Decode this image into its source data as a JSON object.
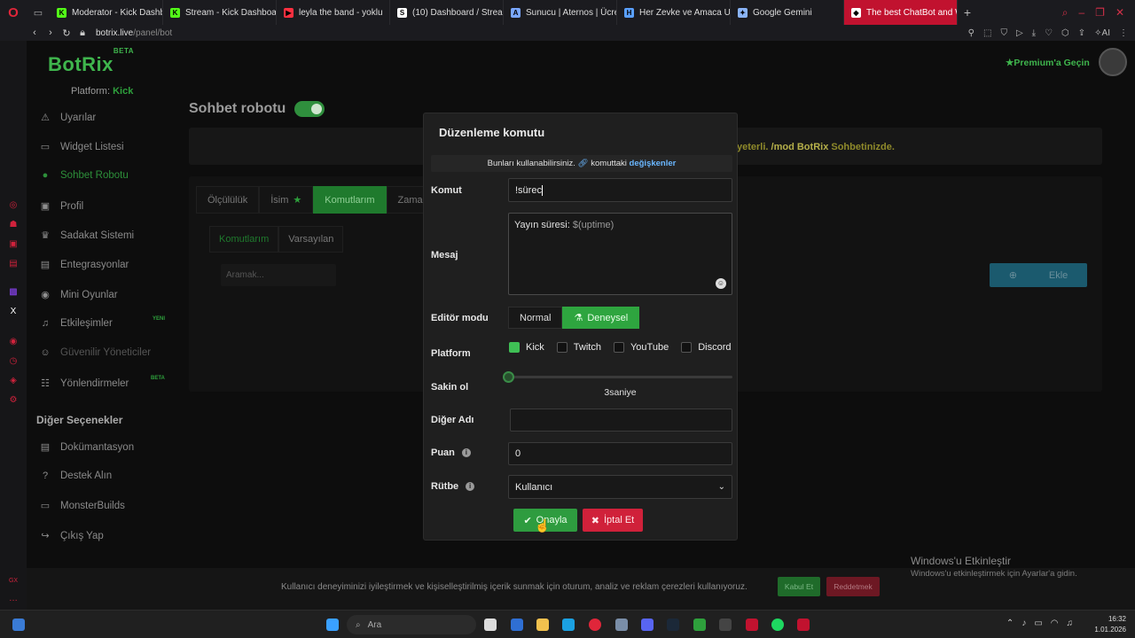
{
  "browser": {
    "tabs": [
      {
        "title": "Moderator - Kick Dashboa",
        "fav_color": "#53fc18",
        "fav": "K"
      },
      {
        "title": "Stream - Kick Dashboard",
        "fav_color": "#53fc18",
        "fav": "K"
      },
      {
        "title": "leyla the band - yoklu",
        "fav_color": "#ff3040",
        "fav": "▶"
      },
      {
        "title": "(10) Dashboard / Streamla",
        "fav_color": "#ffffff",
        "fav": "S"
      },
      {
        "title": "Sunucu | Aternos | Ücretsi",
        "fav_color": "#7aa7ff",
        "fav": "A"
      },
      {
        "title": "Her Zevke ve Amaca Uygu",
        "fav_color": "#5aa0ff",
        "fav": "H"
      },
      {
        "title": "Google Gemini",
        "fav_color": "#8ab4f8",
        "fav": "✦"
      },
      {
        "title": "The best ChatBot and Wid",
        "fav_color": "#ffffff",
        "fav": "◆"
      }
    ],
    "url_host": "botrix.live",
    "url_path": "/panel/bot"
  },
  "site": {
    "logo": "BotRix",
    "logo_badge": "BETA",
    "platform_label": "Platform:",
    "platform_value": "Kick",
    "premium": "Premium'a Geçin",
    "accent": "#3fb54d"
  },
  "sidebar": {
    "items": [
      {
        "label": "Uyarılar",
        "icon": "⚠"
      },
      {
        "label": "Widget Listesi",
        "icon": "▭"
      },
      {
        "label": "Sohbet Robotu",
        "icon": "●"
      },
      {
        "label": "Profil",
        "icon": "▣"
      },
      {
        "label": "Sadakat Sistemi",
        "icon": "♛"
      },
      {
        "label": "Entegrasyonlar",
        "icon": "▤"
      },
      {
        "label": "Mini Oyunlar",
        "icon": "◉"
      },
      {
        "label": "Etkileşimler",
        "icon": "♫"
      },
      {
        "label": "Güvenilir Yöneticiler",
        "icon": "☺"
      },
      {
        "label": "Yönlendirmeler",
        "icon": "☷"
      }
    ],
    "badges": {
      "yeni": "YENI",
      "beta": "BETA"
    },
    "section": "Diğer Seçenekler",
    "others": [
      {
        "label": "Dokümantasyon",
        "icon": "▤"
      },
      {
        "label": "Destek Alın",
        "icon": "?"
      },
      {
        "label": "MonsterBuilds",
        "icon": "▭"
      },
      {
        "label": "Çıkış Yap",
        "icon": "↪"
      }
    ]
  },
  "main": {
    "title": "Sohbet robotu",
    "banner_text": "yeterli.",
    "banner_cmd": "/mod BotRix",
    "banner_tail": "Sohbetinizde.",
    "tabs": [
      "Ölçülülük",
      "İsim",
      "Komutlarım",
      "Zaman"
    ],
    "subtabs": [
      "Komutlarım",
      "Varsayılan"
    ],
    "search_placeholder": "Aramak...",
    "add_label": "Ekle"
  },
  "modal": {
    "title": "Düzenleme komutu",
    "hint_prefix": "Bunları kullanabilirsiniz.",
    "hint_mid": "komuttaki",
    "hint_vars": "değişkenler",
    "command_label": "Komut",
    "command_value": "!sürec",
    "message_label": "Mesaj",
    "message_text": "Yayın süresi: ",
    "message_var": "$(uptime)",
    "editor_label": "Editör modu",
    "editor_normal": "Normal",
    "editor_exp": "Deneysel",
    "platform_label": "Platform",
    "platforms": [
      {
        "name": "Kick",
        "checked": true
      },
      {
        "name": "Twitch",
        "checked": false
      },
      {
        "name": "YouTube",
        "checked": false
      },
      {
        "name": "Discord",
        "checked": false
      }
    ],
    "cooldown_label": "Sakin ol",
    "cooldown_value_text": "3saniye",
    "cooldown_fraction": 0.0,
    "alias_label": "Diğer Adı",
    "alias_value": "",
    "points_label": "Puan",
    "points_value": "0",
    "rank_label": "Rütbe",
    "rank_value": "Kullanıcı",
    "ok_label": "Onayla",
    "cancel_label": "İptal Et"
  },
  "cookie": {
    "text": "Kullanıcı deneyiminizi iyileştirmek ve kişiselleştirilmiş içerik sunmak için oturum, analiz ve reklam çerezleri kullanıyoruz.",
    "accept": "Kabul Et",
    "reject": "Reddetmek"
  },
  "windows": {
    "activate_title": "Windows'u Etkinleştir",
    "activate_sub": "Windows'u etkinleştirmek için Ayarlar'a gidin.",
    "search": "Ara",
    "time": "16:32",
    "date": "1.01.2026"
  }
}
